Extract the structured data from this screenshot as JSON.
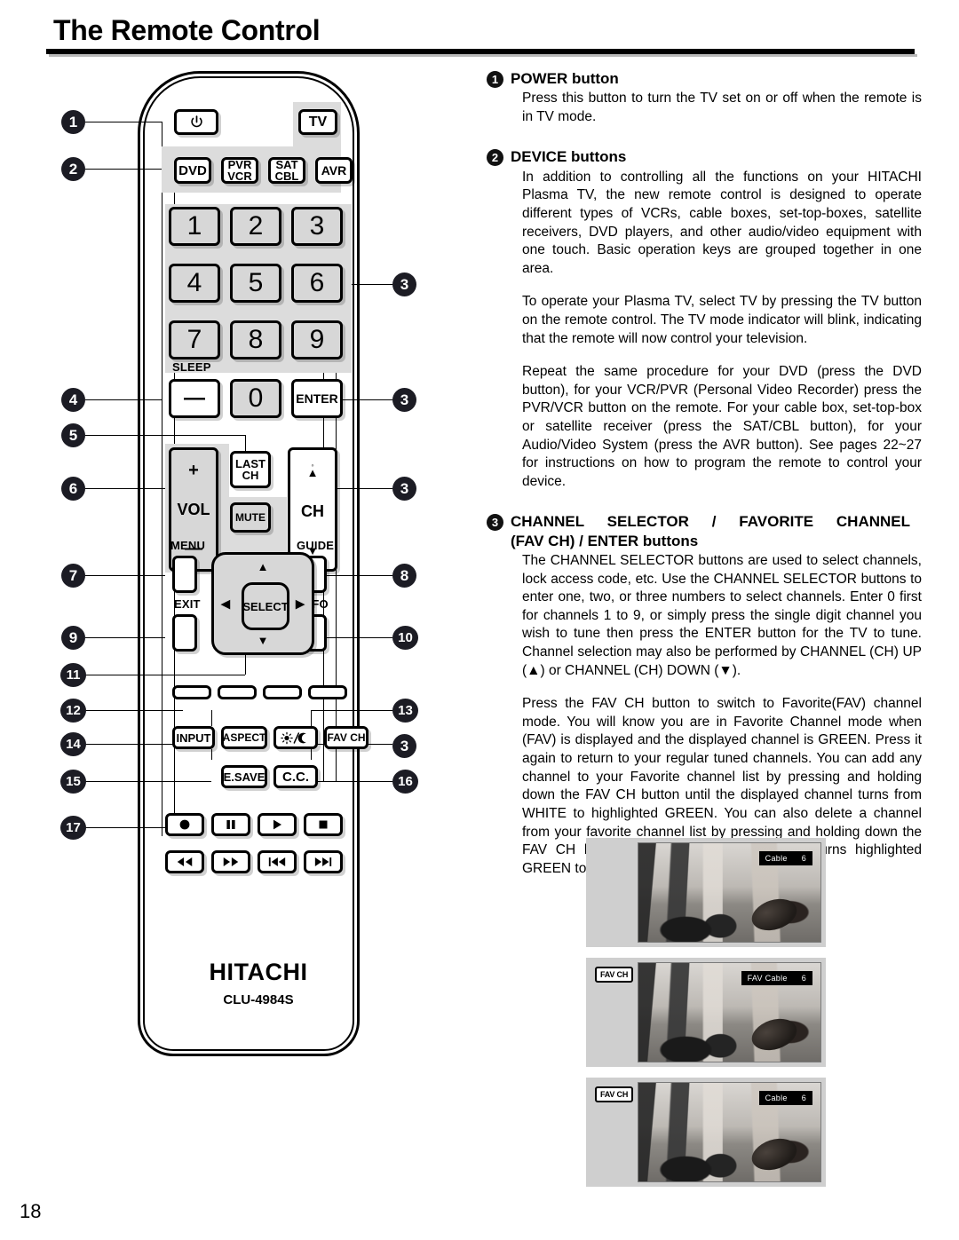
{
  "page": {
    "title": "The Remote Control",
    "number": "18"
  },
  "remote": {
    "brand": "HITACHI",
    "model": "CLU-4984S",
    "keys": {
      "power": "power-icon",
      "tv": "TV",
      "dvd": "DVD",
      "pvr_vcr_line1": "PVR",
      "pvr_vcr_line2": "VCR",
      "sat_cbl_line1": "SAT",
      "sat_cbl_line2": "CBL",
      "avr": "AVR",
      "digits": [
        "1",
        "2",
        "3",
        "4",
        "5",
        "6",
        "7",
        "8",
        "9"
      ],
      "zero": "0",
      "sleep_label": "SLEEP",
      "sleep_dash": "—",
      "enter": "ENTER",
      "vol_plus": "+",
      "vol_label": "VOL",
      "vol_minus": "—",
      "last_ch_line1": "LAST",
      "last_ch_line2": "CH",
      "mute": "MUTE",
      "ch_up": "▲",
      "ch_label": "CH",
      "ch_down": "▼",
      "menu": "MENU",
      "guide": "GUIDE",
      "exit": "EXIT",
      "info": "INFO",
      "select": "SELECT",
      "nav_up": "▲",
      "nav_down": "▼",
      "nav_left": "◀",
      "nav_right": "▶",
      "input": "INPUT",
      "aspect": "ASPECT",
      "daynight": "day-night-icon",
      "fav_ch": "FAV CH",
      "e_save": "E.SAVE",
      "cc": "C.C.",
      "record": "record-icon",
      "pause": "pause-icon",
      "play": "play-icon",
      "stop": "stop-icon",
      "rewind": "rewind-icon",
      "fast_forward": "fast-forward-icon",
      "previous": "previous-track-icon",
      "next": "next-track-icon"
    },
    "callouts_left": [
      "1",
      "2",
      "4",
      "5",
      "6",
      "7",
      "9",
      "11",
      "12",
      "14",
      "15",
      "17"
    ],
    "callouts_right": [
      "3",
      "3",
      "3",
      "8",
      "10",
      "13",
      "3",
      "16"
    ]
  },
  "sections": [
    {
      "num": "❶",
      "title": "POWER button",
      "paragraphs": [
        "Press this button to turn the TV set on or off when the remote is in TV mode."
      ]
    },
    {
      "num": "❷",
      "title": "DEVICE buttons",
      "paragraphs": [
        "In addition to controlling all the functions on your HITACHI Plasma TV, the new remote control is designed to operate different types of VCRs, cable boxes, set-top-boxes, satellite receivers, DVD players, and other audio/video equipment with one touch. Basic operation keys are grouped together in one area.",
        "To operate your Plasma TV, select TV by pressing the TV button on the remote control. The TV mode indicator will blink, indicating that the remote will now control your television.",
        "Repeat the same procedure for your DVD (press the DVD button), for your VCR/PVR (Personal Video Recorder) press the PVR/VCR button on the remote. For your cable box, set-top-box or satellite receiver (press the SAT/CBL button), for your Audio/Video System (press the AVR button). See pages 22~27 for instructions on how to program the remote to control your device."
      ]
    },
    {
      "num": "❸",
      "title_line1": "CHANNEL   SELECTOR   /   FAVORITE   CHANNEL",
      "title_line2": "(FAV CH) / ENTER buttons",
      "paragraphs": [
        "The CHANNEL SELECTOR buttons are used to select channels, lock access code, etc. Use the CHANNEL SELECTOR buttons to enter one, two, or three numbers to select channels. Enter 0 first for channels 1 to 9, or simply press the single digit channel you wish to tune then press the ENTER button for the TV to tune. Channel selection may also be performed by CHANNEL (CH) UP (▲) or CHANNEL (CH) DOWN (▼).",
        "Press the FAV CH button to switch to Favorite(FAV) channel mode. You will know you are in Favorite Channel mode when (FAV) is displayed and the displayed channel is GREEN. Press it again to return to your regular tuned channels. You can add any channel to your Favorite channel list by pressing and holding down the FAV CH button until the displayed channel turns from WHITE to highlighted GREEN. You can also delete a channel from your favorite channel list by pressing and holding down the FAV CH button until the displayed channel turns highlighted GREEN to WHITE."
      ]
    }
  ],
  "tv_shots": [
    {
      "tag": "",
      "osd_label": "Cable",
      "osd_channel": "6"
    },
    {
      "tag": "FAV CH",
      "osd_label": "FAV Cable",
      "osd_channel": "6"
    },
    {
      "tag": "FAV CH",
      "osd_label": "Cable",
      "osd_channel": "6"
    }
  ]
}
